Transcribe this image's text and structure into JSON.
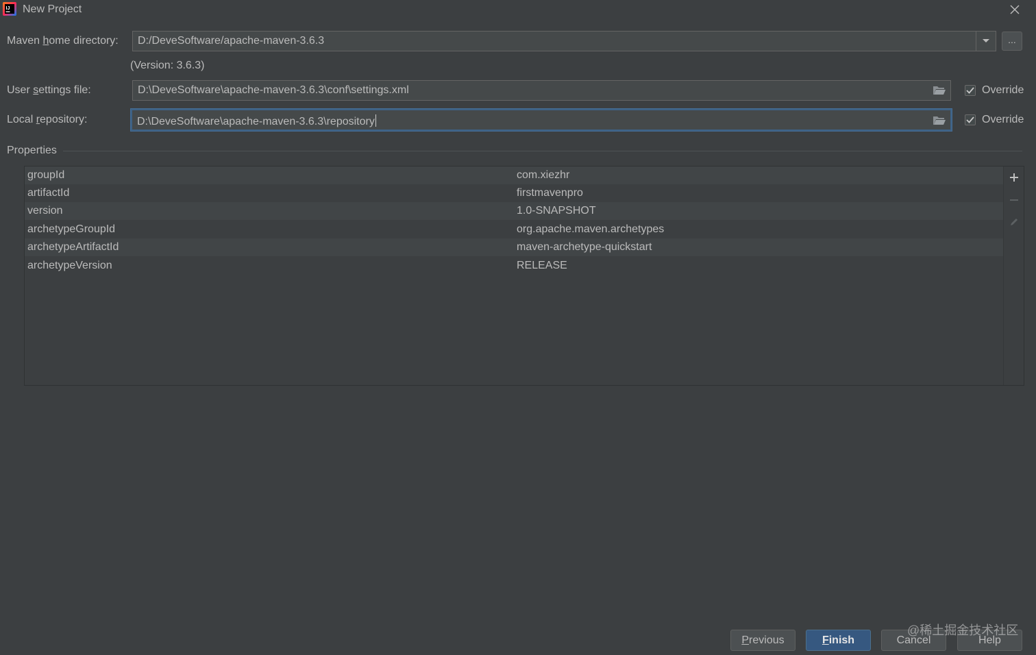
{
  "window": {
    "title": "New Project",
    "icon": "intellij-idea-icon"
  },
  "maven_home": {
    "label_pre": "Maven ",
    "label_mnemonic": "h",
    "label_post": "ome directory:",
    "value": "D:/DeveSoftware/apache-maven-3.6.3",
    "version_text": "(Version: 3.6.3)",
    "browse_label": "..."
  },
  "user_settings": {
    "label_pre": "User ",
    "label_mnemonic": "s",
    "label_post": "ettings file:",
    "value": "D:\\DeveSoftware\\apache-maven-3.6.3\\conf\\settings.xml",
    "override_label": "Override",
    "override_checked": true
  },
  "local_repo": {
    "label_pre": "Local ",
    "label_mnemonic": "r",
    "label_post": "epository:",
    "value": "D:\\DeveSoftware\\apache-maven-3.6.3\\repository",
    "override_label": "Override",
    "override_checked": true
  },
  "properties": {
    "title": "Properties",
    "rows": [
      {
        "key": "groupId",
        "value": "com.xiezhr"
      },
      {
        "key": "artifactId",
        "value": "firstmavenpro"
      },
      {
        "key": "version",
        "value": "1.0-SNAPSHOT"
      },
      {
        "key": "archetypeGroupId",
        "value": "org.apache.maven.archetypes"
      },
      {
        "key": "archetypeArtifactId",
        "value": "maven-archetype-quickstart"
      },
      {
        "key": "archetypeVersion",
        "value": "RELEASE"
      }
    ]
  },
  "buttons": {
    "previous_mnemonic": "P",
    "previous_rest": "revious",
    "finish_mnemonic": "F",
    "finish_rest": "inish",
    "cancel": "Cancel",
    "help": "Help"
  },
  "watermark": "@稀土掘金技术社区",
  "colors": {
    "background": "#3c3f41",
    "focus_border": "#3d6185",
    "primary_button": "#365880"
  }
}
